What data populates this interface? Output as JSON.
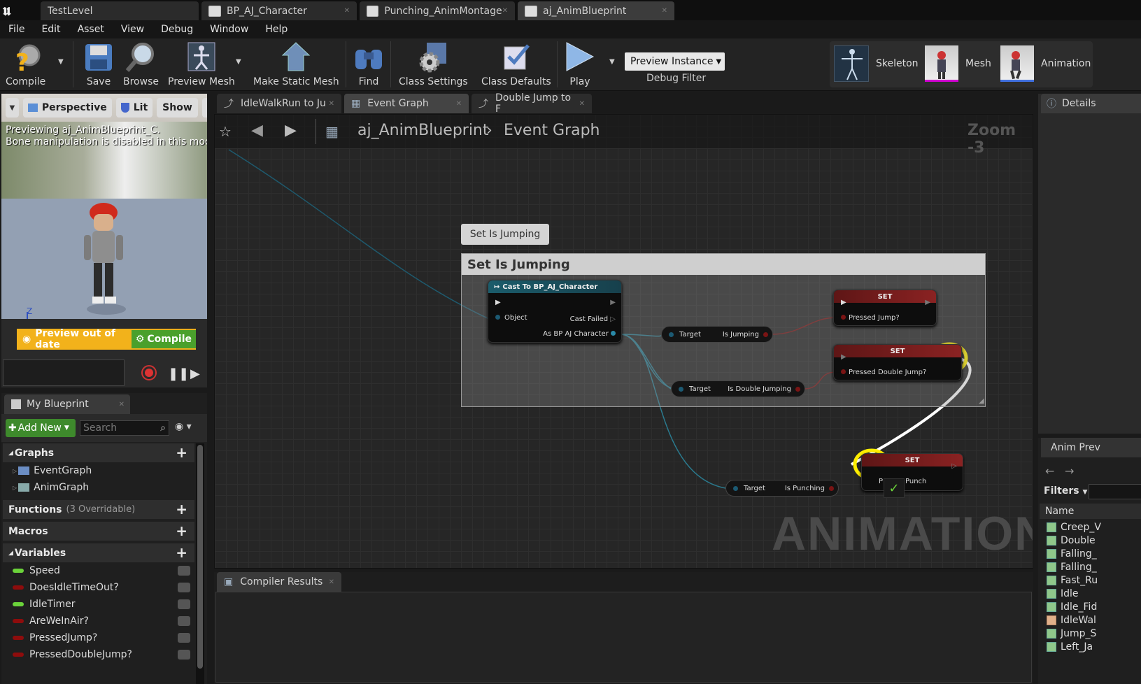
{
  "app_tabs": [
    {
      "label": "TestLevel"
    },
    {
      "label": "BP_AJ_Character"
    },
    {
      "label": "Punching_AnimMontage"
    },
    {
      "label": "aj_AnimBlueprint"
    }
  ],
  "menu": [
    "File",
    "Edit",
    "Asset",
    "View",
    "Debug",
    "Window",
    "Help"
  ],
  "toolbar": {
    "compile": "Compile",
    "save": "Save",
    "browse": "Browse",
    "preview_mesh": "Preview Mesh",
    "make_static_mesh": "Make Static Mesh",
    "find": "Find",
    "class_settings": "Class Settings",
    "class_defaults": "Class Defaults",
    "play": "Play",
    "preview_instance": "Preview Instance",
    "debug_filter": "Debug Filter",
    "modes": [
      "Skeleton",
      "Mesh",
      "Animation"
    ]
  },
  "viewport": {
    "perspective": "Perspective",
    "lit": "Lit",
    "show": "Show",
    "preview_line1": "Previewing aj_AnimBlueprint_C.",
    "preview_line2": "Bone manipulation is disabled in this mode.",
    "axis_label": "Z",
    "preview_out_of_date": "Preview out of date",
    "compile": "Compile"
  },
  "my_blueprint": {
    "tab": "My Blueprint",
    "add_new": "Add New",
    "search_placeholder": "Search",
    "graphs_header": "Graphs",
    "graphs": [
      "EventGraph",
      "AnimGraph"
    ],
    "functions_header": "Functions",
    "functions_note": "(3 Overridable)",
    "macros_header": "Macros",
    "variables_header": "Variables",
    "variables": [
      {
        "name": "Speed",
        "color": "#6bd33a"
      },
      {
        "name": "DoesIdleTimeOut?",
        "color": "#8e0c0c"
      },
      {
        "name": "IdleTimer",
        "color": "#6bd33a"
      },
      {
        "name": "AreWeInAir?",
        "color": "#8e0c0c"
      },
      {
        "name": "PressedJump?",
        "color": "#8e0c0c"
      },
      {
        "name": "PressedDoubleJump?",
        "color": "#8e0c0c"
      }
    ]
  },
  "graph_tabs": [
    {
      "label": "IdleWalkRun to Ju"
    },
    {
      "label": "Event Graph"
    },
    {
      "label": "Double Jump to F"
    }
  ],
  "graph": {
    "breadcrumb_root": "aj_AnimBlueprint",
    "breadcrumb_leaf": "Event Graph",
    "zoom": "Zoom -3",
    "comment_bubble": "Set Is Jumping",
    "comment_title": "Set Is Jumping",
    "watermark": "ANIMATION",
    "cast_node": {
      "title": "Cast To BP_AJ_Character",
      "object": "Object",
      "cast_failed": "Cast Failed",
      "as_char": "As BP AJ Character"
    },
    "get_jumping": {
      "target": "Target",
      "value": "Is Jumping"
    },
    "get_double": {
      "target": "Target",
      "value": "Is Double Jumping"
    },
    "get_punching": {
      "target": "Target",
      "value": "Is Punching"
    },
    "set1": {
      "title": "SET",
      "pin": "Pressed Jump?"
    },
    "set2": {
      "title": "SET",
      "pin": "Pressed Double Jump?"
    },
    "set3": {
      "title": "SET",
      "pin_prefix": "P",
      "pin": "Punch"
    }
  },
  "compiler_results": {
    "tab": "Compiler Results"
  },
  "details": {
    "tab": "Details"
  },
  "anim_preview": {
    "tab": "Anim Prev",
    "filters": "Filters",
    "name_header": "Name",
    "assets": [
      "Creep_V",
      "Double",
      "Falling_",
      "Falling_",
      "Fast_Ru",
      "Idle",
      "Idle_Fid",
      "IdleWal",
      "Jump_S",
      "Left_Ja"
    ]
  },
  "colors": {
    "accent_yellow": "#ffee00",
    "bool_pin": "#8e0c0c",
    "float_pin": "#6bd33a",
    "cast_header": "#1b5c6b",
    "set_header": "#7a1b1b"
  }
}
